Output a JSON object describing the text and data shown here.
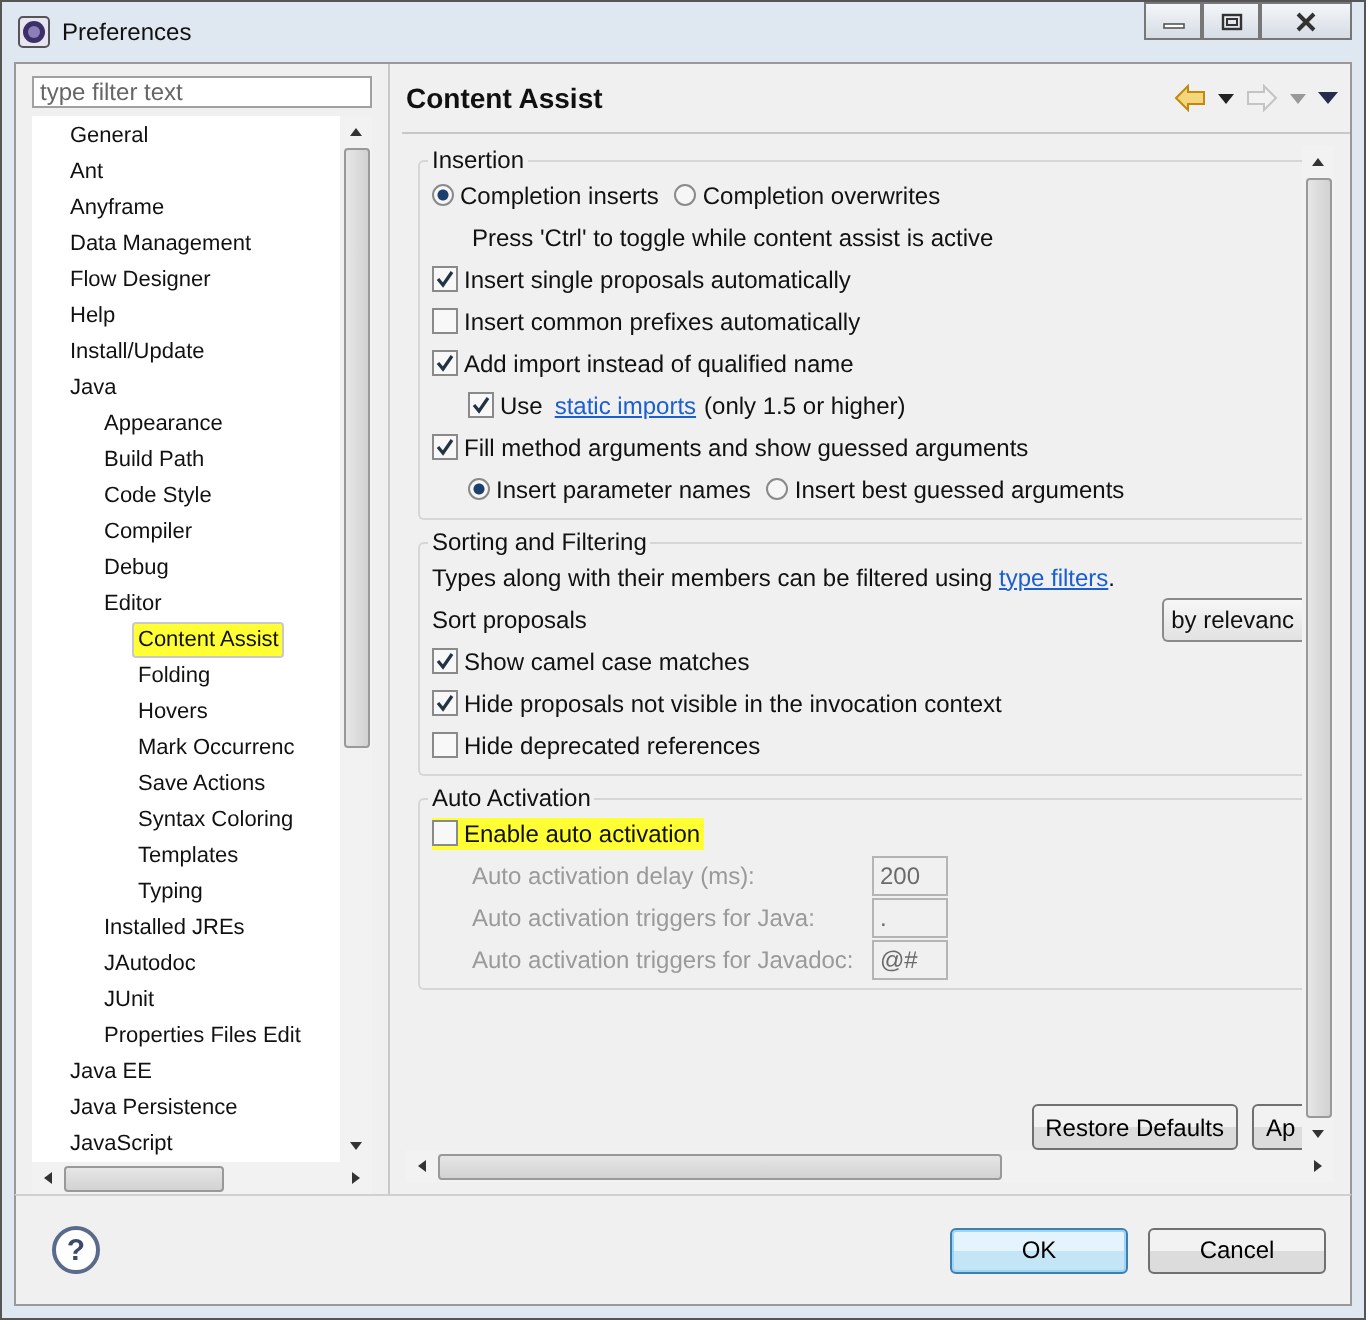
{
  "window": {
    "title": "Preferences"
  },
  "filter": {
    "placeholder": "type filter text"
  },
  "tree": {
    "items": [
      {
        "label": "General",
        "selected": false,
        "highlighted": false
      },
      {
        "label": "Ant",
        "selected": false,
        "highlighted": false
      },
      {
        "label": "Anyframe",
        "selected": false,
        "highlighted": false
      },
      {
        "label": "Data Management",
        "selected": false,
        "highlighted": false
      },
      {
        "label": "Flow Designer",
        "selected": false,
        "highlighted": false
      },
      {
        "label": "Help",
        "selected": false,
        "highlighted": false
      },
      {
        "label": "Install/Update",
        "selected": false,
        "highlighted": false
      },
      {
        "label": "Java",
        "selected": false,
        "highlighted": false,
        "children": [
          {
            "label": "Appearance",
            "selected": false,
            "highlighted": false
          },
          {
            "label": "Build Path",
            "selected": false,
            "highlighted": false
          },
          {
            "label": "Code Style",
            "selected": false,
            "highlighted": false
          },
          {
            "label": "Compiler",
            "selected": false,
            "highlighted": false
          },
          {
            "label": "Debug",
            "selected": false,
            "highlighted": false
          },
          {
            "label": "Editor",
            "selected": false,
            "highlighted": false,
            "children": [
              {
                "label": "Content Assist",
                "selected": true,
                "highlighted": true
              },
              {
                "label": "Folding",
                "selected": false,
                "highlighted": false
              },
              {
                "label": "Hovers",
                "selected": false,
                "highlighted": false
              },
              {
                "label": "Mark Occurrenc",
                "selected": false,
                "highlighted": false
              },
              {
                "label": "Save Actions",
                "selected": false,
                "highlighted": false
              },
              {
                "label": "Syntax Coloring",
                "selected": false,
                "highlighted": false
              },
              {
                "label": "Templates",
                "selected": false,
                "highlighted": false
              },
              {
                "label": "Typing",
                "selected": false,
                "highlighted": false
              }
            ]
          },
          {
            "label": "Installed JREs",
            "selected": false,
            "highlighted": false
          },
          {
            "label": "JAutodoc",
            "selected": false,
            "highlighted": false
          },
          {
            "label": "JUnit",
            "selected": false,
            "highlighted": false
          },
          {
            "label": "Properties Files Edit",
            "selected": false,
            "highlighted": false
          }
        ]
      },
      {
        "label": "Java EE",
        "selected": false,
        "highlighted": false
      },
      {
        "label": "Java Persistence",
        "selected": false,
        "highlighted": false
      },
      {
        "label": "JavaScript",
        "selected": false,
        "highlighted": false
      }
    ]
  },
  "page": {
    "title": "Content Assist",
    "back_enabled": true,
    "forward_enabled": false
  },
  "groups": [
    {
      "title": "Insertion",
      "items": [
        {
          "kind": "radios",
          "options": [
            {
              "label": "Completion inserts",
              "selected": true
            },
            {
              "label": "Completion overwrites",
              "selected": false
            }
          ]
        },
        {
          "kind": "note",
          "text": "Press 'Ctrl' to toggle while content assist is active"
        },
        {
          "kind": "checkbox",
          "label": "Insert single proposals automatically",
          "checked": true,
          "highlighted": false
        },
        {
          "kind": "checkbox",
          "label": "Insert common prefixes automatically",
          "checked": false,
          "highlighted": false
        },
        {
          "kind": "checkbox",
          "label": "Add import instead of qualified name",
          "checked": true,
          "highlighted": false,
          "children": [
            {
              "kind": "checkbox",
              "label": "Use",
              "link": "static imports",
              "after": "(only 1.5 or higher)",
              "checked": true,
              "highlighted": false
            }
          ]
        },
        {
          "kind": "checkbox",
          "label": "Fill method arguments and show guessed arguments",
          "checked": true,
          "highlighted": false,
          "children": [
            {
              "kind": "radios",
              "options": [
                {
                  "label": "Insert parameter names",
                  "selected": true
                },
                {
                  "label": "Insert best guessed arguments",
                  "selected": false
                }
              ]
            }
          ]
        }
      ]
    },
    {
      "title": "Sorting and Filtering",
      "items": [
        {
          "kind": "text",
          "text": "Types along with their members can be filtered using",
          "link": "type filters",
          "after": "."
        },
        {
          "kind": "select",
          "label": "Sort proposals",
          "value": "by relevanc"
        },
        {
          "kind": "checkbox",
          "label": "Show camel case matches",
          "checked": true,
          "highlighted": false
        },
        {
          "kind": "checkbox",
          "label": "Hide proposals not visible in the invocation context",
          "checked": true,
          "highlighted": false
        },
        {
          "kind": "checkbox",
          "label": "Hide deprecated references",
          "checked": false,
          "highlighted": false
        }
      ]
    },
    {
      "title": "Auto Activation",
      "items": [
        {
          "kind": "checkbox",
          "label": "Enable auto activation",
          "checked": false,
          "highlighted": true
        },
        {
          "kind": "field",
          "label": "Auto activation delay (ms):",
          "value": "200",
          "disabled": true
        },
        {
          "kind": "field",
          "label": "Auto activation triggers for Java:",
          "value": ".",
          "disabled": true
        },
        {
          "kind": "field",
          "label": "Auto activation triggers for Javadoc:",
          "value": "@#",
          "disabled": true
        }
      ]
    }
  ],
  "page_buttons": [
    "Restore Defaults",
    "Ap"
  ],
  "help": {
    "label": "?"
  },
  "buttons": [
    {
      "label": "OK",
      "default": true
    },
    {
      "label": "Cancel",
      "default": false
    }
  ]
}
